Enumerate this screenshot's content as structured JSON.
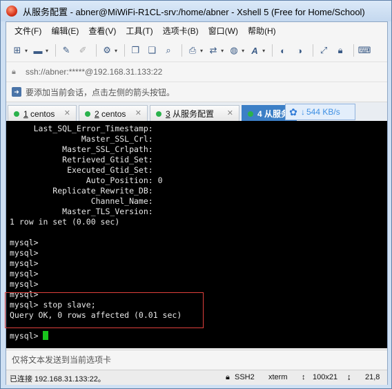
{
  "window": {
    "title": "从服务配置 - abner@MiWiFi-R1CL-srv:/home/abner - Xshell 5 (Free for Home/School)"
  },
  "menu": [
    "文件(F)",
    "编辑(E)",
    "查看(V)",
    "工具(T)",
    "选项卡(B)",
    "窗口(W)",
    "帮助(H)"
  ],
  "toolbar_icons": [
    "new-session-icon",
    "open-folder-icon",
    "pen-icon",
    "erase-icon",
    "settings-icon",
    "copy-icon",
    "paste-icon",
    "find-icon",
    "print-icon",
    "transfer-icon",
    "globe-icon",
    "font-icon",
    "xftp-icon",
    "xmanager-icon",
    "fullscreen-icon",
    "lock-icon",
    "keyboard-icon"
  ],
  "address": {
    "text": "ssh://abner:*****@192.168.31.133:22"
  },
  "hint": {
    "text": "要添加当前会话，点击左侧的箭头按钮。"
  },
  "tabs": [
    {
      "num": "1",
      "label": "centos"
    },
    {
      "num": "2",
      "label": "centos"
    },
    {
      "num": "3",
      "label": "从服务配置"
    },
    {
      "num": "4",
      "label": "从服务"
    }
  ],
  "netmon": {
    "speed": "544 KB/s"
  },
  "terminal": {
    "lines": [
      "     Last_SQL_Error_Timestamp:",
      "               Master_SSL_Crl:",
      "           Master_SSL_Crlpath:",
      "           Retrieved_Gtid_Set:",
      "            Executed_Gtid_Set:",
      "                Auto_Position: 0",
      "         Replicate_Rewrite_DB:",
      "                 Channel_Name:",
      "           Master_TLS_Version:",
      "1 row in set (0.00 sec)",
      "",
      "mysql>",
      "mysql>",
      "mysql>",
      "mysql>",
      "mysql>",
      "mysql>",
      "mysql> stop slave;",
      "Query OK, 0 rows affected (0.01 sec)",
      "",
      "mysql> "
    ]
  },
  "sendbar": {
    "placeholder": "仅将文本发送到当前选项卡"
  },
  "status": {
    "connection": "已连接 192.168.31.133:22。",
    "protocol": "SSH2",
    "terminal_type": "xterm",
    "size": "100x21",
    "cursor": "21,8"
  }
}
